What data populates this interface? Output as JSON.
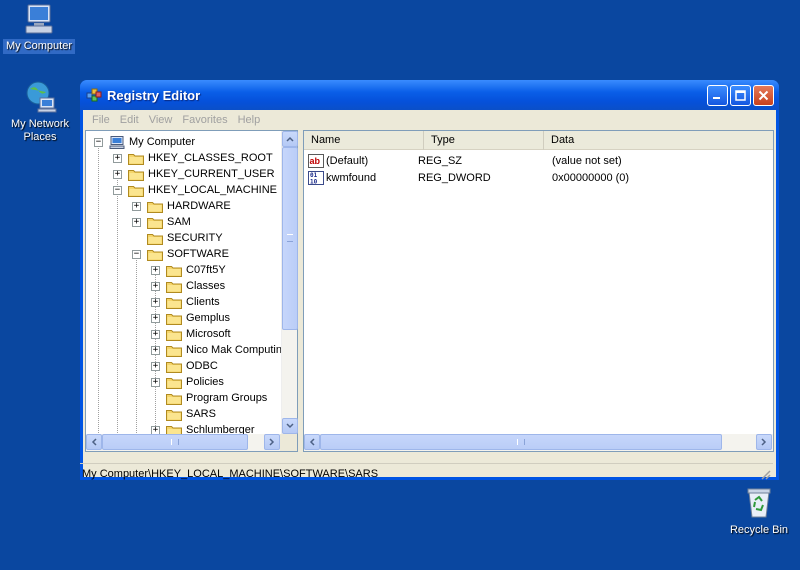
{
  "desktop": {
    "icons": [
      {
        "label": "My Computer"
      },
      {
        "label": "My Network Places"
      },
      {
        "label": "Recycle Bin"
      }
    ]
  },
  "window": {
    "title": "Registry Editor",
    "menu": [
      "File",
      "Edit",
      "View",
      "Favorites",
      "Help"
    ],
    "status_path": "My Computer\\HKEY_LOCAL_MACHINE\\SOFTWARE\\SARS"
  },
  "tree": [
    {
      "label": "My Computer",
      "expander": "−"
    },
    {
      "label": "HKEY_CLASSES_ROOT",
      "expander": "+"
    },
    {
      "label": "HKEY_CURRENT_USER",
      "expander": "+"
    },
    {
      "label": "HKEY_LOCAL_MACHINE",
      "expander": "−"
    },
    {
      "label": "HARDWARE",
      "expander": "+"
    },
    {
      "label": "SAM",
      "expander": "+"
    },
    {
      "label": "SECURITY",
      "expander": ""
    },
    {
      "label": "SOFTWARE",
      "expander": "−"
    },
    {
      "label": "C07ft5Y",
      "expander": "+"
    },
    {
      "label": "Classes",
      "expander": "+"
    },
    {
      "label": "Clients",
      "expander": "+"
    },
    {
      "label": "Gemplus",
      "expander": "+"
    },
    {
      "label": "Microsoft",
      "expander": "+"
    },
    {
      "label": "Nico Mak Computing",
      "expander": "+"
    },
    {
      "label": "ODBC",
      "expander": "+"
    },
    {
      "label": "Policies",
      "expander": "+"
    },
    {
      "label": "Program Groups",
      "expander": ""
    },
    {
      "label": "SARS",
      "expander": ""
    },
    {
      "label": "Schlumberger",
      "expander": "+"
    }
  ],
  "list": {
    "columns": [
      "Name",
      "Type",
      "Data"
    ],
    "rows": [
      {
        "name": "(Default)",
        "type": "REG_SZ",
        "data": "(value not set)",
        "icon": "string-value-icon"
      },
      {
        "name": "kwmfound",
        "type": "REG_DWORD",
        "data": "0x00000000 (0)",
        "icon": "binary-value-icon"
      }
    ]
  }
}
